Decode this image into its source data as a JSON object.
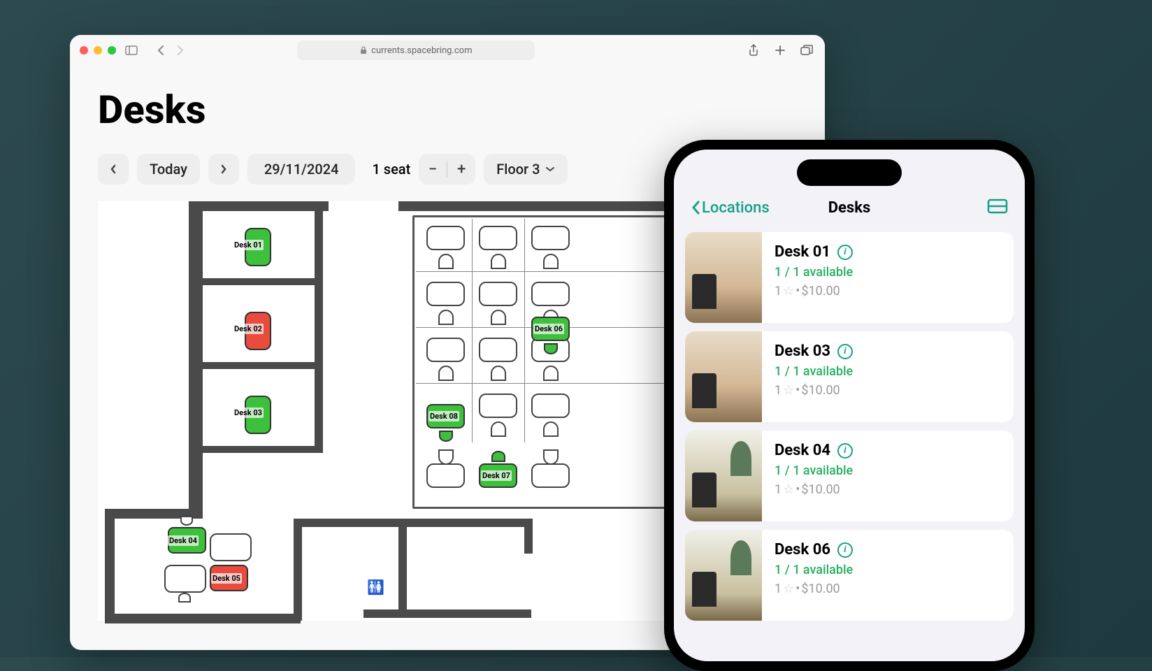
{
  "browser": {
    "url": "currents.spacebring.com"
  },
  "page": {
    "title": "Desks"
  },
  "toolbar": {
    "today": "Today",
    "date": "29/11/2024",
    "seat_count": "1 seat",
    "seat_minus": "−",
    "seat_plus": "+",
    "floor": "Floor 3"
  },
  "floorplan": {
    "desks": [
      {
        "id": "Desk 01",
        "status": "available"
      },
      {
        "id": "Desk 02",
        "status": "occupied"
      },
      {
        "id": "Desk 03",
        "status": "available"
      },
      {
        "id": "Desk 04",
        "status": "available"
      },
      {
        "id": "Desk 05",
        "status": "occupied"
      },
      {
        "id": "Desk 06",
        "status": "available"
      },
      {
        "id": "Desk 07",
        "status": "available"
      },
      {
        "id": "Desk 08",
        "status": "available"
      }
    ]
  },
  "phone": {
    "back_label": "Locations",
    "title": "Desks",
    "desks": [
      {
        "name": "Desk 01",
        "availability": "1 / 1 available",
        "price_prefix": "1",
        "price": "$10.00"
      },
      {
        "name": "Desk 03",
        "availability": "1 / 1 available",
        "price_prefix": "1",
        "price": "$10.00"
      },
      {
        "name": "Desk 04",
        "availability": "1 / 1 available",
        "price_prefix": "1",
        "price": "$10.00"
      },
      {
        "name": "Desk 06",
        "availability": "1 / 1 available",
        "price_prefix": "1",
        "price": "$10.00"
      }
    ]
  }
}
